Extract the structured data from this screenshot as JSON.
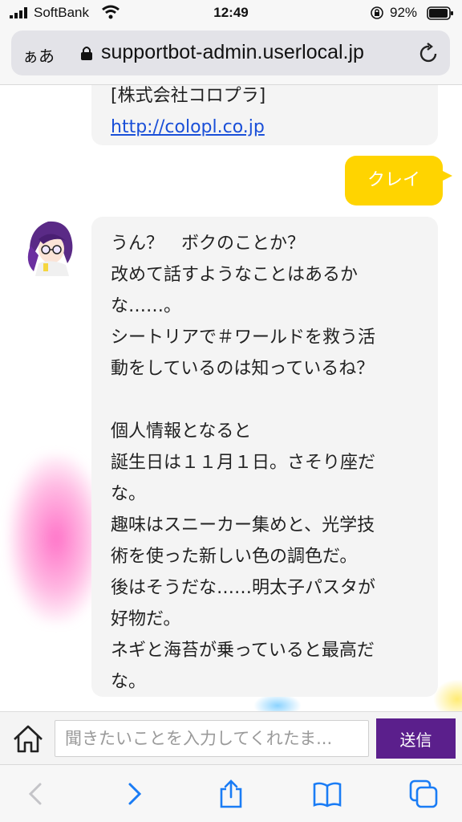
{
  "status_bar": {
    "carrier": "SoftBank",
    "time": "12:49",
    "battery": "92%"
  },
  "browser": {
    "aa_label": "ぁあ",
    "url": "supportbot-admin.userlocal.jp"
  },
  "chat": {
    "prev_bot": {
      "company": "[株式会社コロプラ]",
      "link": "http://colopl.co.jp"
    },
    "user_message": "クレイ",
    "bot_message_lines": [
      "うん？　ボクのことか？",
      "改めて話すようなことはあるか",
      "な……。",
      "シートリアで＃ワールドを救う活",
      "動をしているのは知っているね？",
      "",
      "個人情報となると",
      "誕生日は１１月１日。さそり座だ",
      "な。",
      "趣味はスニーカー集めと、光学技",
      "術を使った新しい色の調色だ。",
      "後はそうだな……明太子パスタが",
      "好物だ。",
      "ネギと海苔が乗っていると最高だ",
      "な。"
    ]
  },
  "input_bar": {
    "placeholder": "聞きたいことを入力してくれたま...",
    "send_label": "送信"
  },
  "colors": {
    "user_bubble": "#ffd400",
    "bot_bubble": "#f4f4f4",
    "send_button": "#5b1f8c",
    "link": "#1a4fd8",
    "toolbar_accent": "#1a7cf5"
  },
  "icons": {
    "status": [
      "signal-icon",
      "wifi-icon",
      "rotation-lock-icon",
      "battery-icon"
    ],
    "browser": [
      "lock-icon",
      "reload-icon"
    ],
    "toolbar": [
      "back-icon",
      "forward-icon",
      "share-icon",
      "bookmarks-icon",
      "tabs-icon"
    ],
    "input": [
      "home-icon"
    ]
  }
}
